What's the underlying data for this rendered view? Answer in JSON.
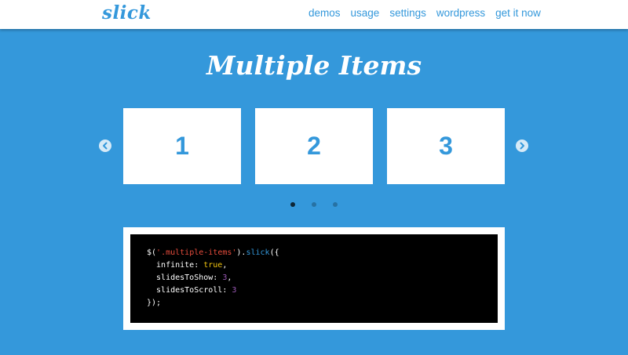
{
  "brand": {
    "logo": "slick",
    "accent": "#3498db"
  },
  "nav": {
    "items": [
      "demos",
      "usage",
      "settings",
      "wordpress",
      "get it now"
    ]
  },
  "title": "Multiple Items",
  "carousel": {
    "slides": [
      "1",
      "2",
      "3"
    ],
    "prev_icon": "chevron-left-icon",
    "next_icon": "chevron-right-icon",
    "dots_count": 3,
    "active_dot": 1
  },
  "code": {
    "l1": {
      "a": "$(",
      "b": "'.multiple-items'",
      "c": ").",
      "d": "slick",
      "e": "({"
    },
    "l2": {
      "a": "  infinite: ",
      "b": "true",
      "c": ","
    },
    "l3": {
      "a": "  slidesToShow: ",
      "b": "3",
      "c": ","
    },
    "l4": {
      "a": "  slidesToScroll: ",
      "b": "3"
    },
    "l5": "});",
    "colors": {
      "string": "#e74c3c",
      "function": "#3498db",
      "boolean": "#f1c40f",
      "number": "#9b59b6"
    }
  }
}
